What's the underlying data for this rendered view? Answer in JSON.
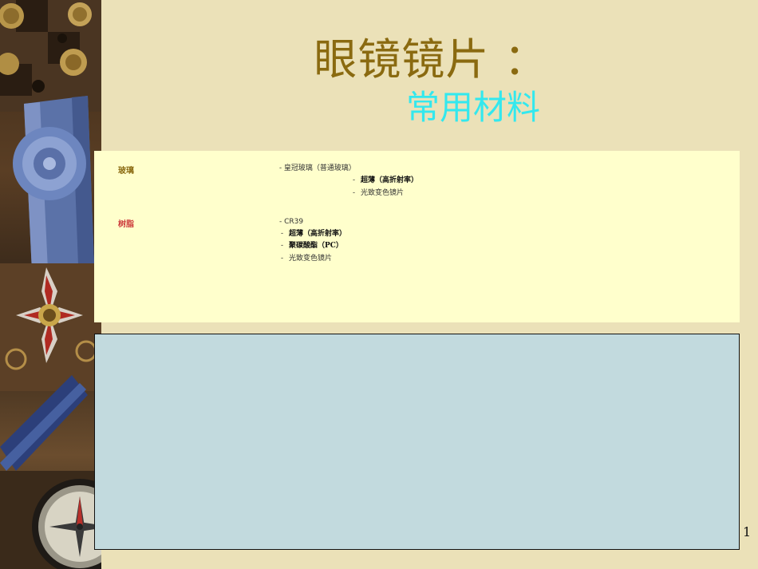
{
  "slide": {
    "title": "眼镜镜片 ：",
    "subtitle": "常用材料",
    "page_number": "1"
  },
  "materials": {
    "glass": {
      "label": "玻璃",
      "items": [
        "- 皇冠玻璃（普通玻璃）",
        "超薄（高折射率）",
        "光致变色镜片"
      ]
    },
    "resin": {
      "label": "树脂",
      "items": [
        "- CR39",
        "超薄（高折射率）",
        "聚碳酸酯（PC）",
        "光致变色镜片"
      ]
    }
  },
  "colors": {
    "background": "#ebe1b8",
    "title": "#8a6a10",
    "subtitle": "#33e8ee",
    "panel": "#ffffcc",
    "box": "#c2dade",
    "resin_label": "#cc3a3a"
  }
}
